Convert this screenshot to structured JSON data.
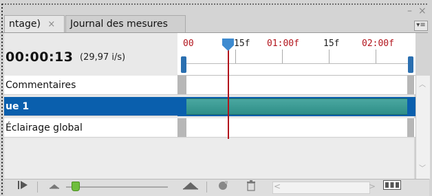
{
  "window": {
    "minimize_glyph": "–",
    "close_glyph": "×",
    "panel_menu_glyph": "▾≡"
  },
  "tabs": [
    {
      "label": "ntage)",
      "close_glyph": "×",
      "active": true
    },
    {
      "label": "Journal des mesures",
      "active": false
    }
  ],
  "timeline": {
    "current_time": "00:00:13",
    "frame_rate": "(29,97 i/s)",
    "ruler_labels": [
      "00",
      "15f",
      "01:00f",
      "15f",
      "02:00f"
    ],
    "layers": [
      {
        "name": "Commentaires",
        "selected": false
      },
      {
        "name": "ue 1",
        "selected": true
      },
      {
        "name": "Éclairage global",
        "selected": false
      }
    ]
  },
  "colors": {
    "selected_row": "#0a5fad",
    "track_bar": "#3a9b94",
    "playhead": "#b2131b",
    "ruler_label_red": "#b2131b"
  },
  "toolbar": {
    "icons": [
      "play-icon",
      "zoom-out-mountain-icon",
      "zoom-slider",
      "zoom-in-mountain-icon",
      "convert-animation-icon",
      "duplicate-icon",
      "trash-icon",
      "scroll-left-icon",
      "scroll-right-icon",
      "frames-mode-icon"
    ]
  }
}
